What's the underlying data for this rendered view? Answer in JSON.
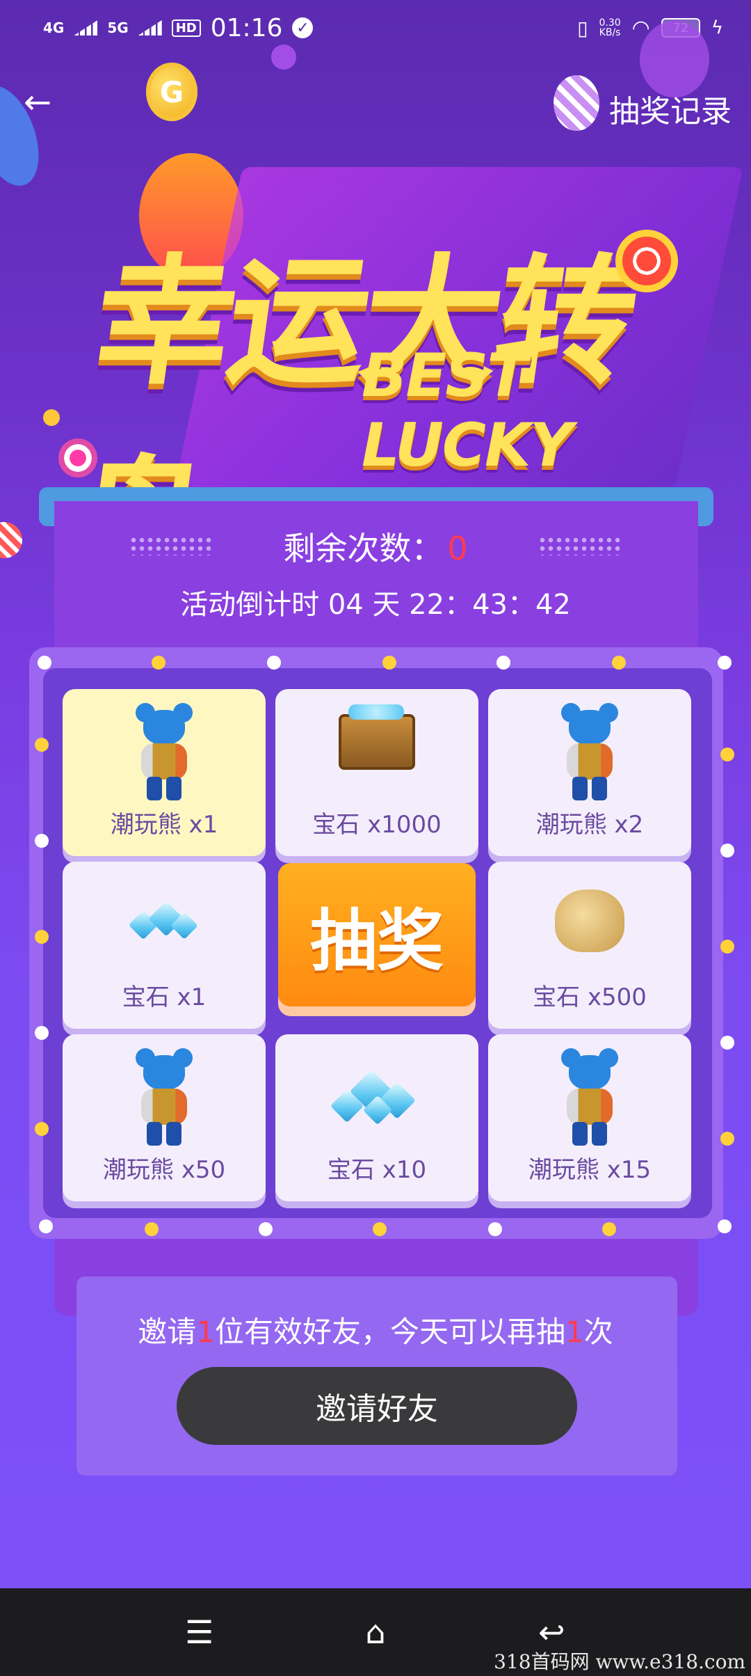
{
  "status_bar": {
    "net1": "4G",
    "net2": "5G",
    "hd": "HD",
    "time": "01:16",
    "speed_value": "0.30",
    "speed_unit": "KB/s",
    "battery": "72"
  },
  "header": {
    "back_icon": "←",
    "records_label": "抽奖记录"
  },
  "banner": {
    "title_cn": "幸运大转盘",
    "title_en": "BEST LUCKY"
  },
  "info": {
    "remaining_label": "剩余次数：",
    "remaining_value": "0",
    "countdown_label": "活动倒计时",
    "countdown_days": "04",
    "countdown_day_unit": "天",
    "countdown_time": "22：43：42"
  },
  "prizes": [
    {
      "label": "潮玩熊 x1",
      "icon": "bear-icon",
      "active": true
    },
    {
      "label": "宝石 x1000",
      "icon": "treasure-chest-icon",
      "active": false
    },
    {
      "label": "潮玩熊 x2",
      "icon": "bear-icon",
      "active": false
    },
    {
      "label": "宝石 x1",
      "icon": "gem-icon",
      "active": false
    },
    {
      "label": "宝石 x500",
      "icon": "gem-sack-icon",
      "active": false
    },
    {
      "label": "潮玩熊 x50",
      "icon": "bear-icon",
      "active": false
    },
    {
      "label": "宝石 x10",
      "icon": "gem-pile-icon",
      "active": false
    },
    {
      "label": "潮玩熊 x15",
      "icon": "bear-icon",
      "active": false
    }
  ],
  "draw_button": "抽奖",
  "invite": {
    "text_prefix": "邀请",
    "count1": "1",
    "text_middle": "位有效好友，今天可以再抽",
    "count2": "1",
    "text_suffix": "次",
    "button_label": "邀请好友"
  },
  "nav": {
    "menu_icon": "menu-icon",
    "home_icon": "home-icon",
    "back_icon": "back-icon"
  },
  "watermark": "318首码网  www.e318.com",
  "colors": {
    "accent_orange": "#ff8a10",
    "highlight_red": "#ff3b4e",
    "active_cell": "#fff7c2"
  }
}
